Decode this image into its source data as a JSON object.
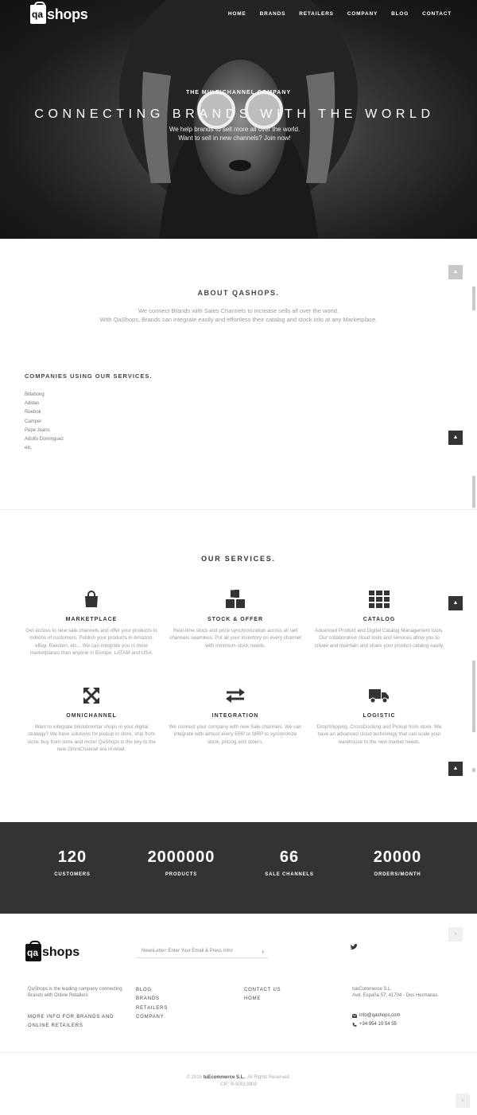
{
  "brand": {
    "logo_letters": "qa",
    "logo_word": "shops"
  },
  "nav": [
    "HOME",
    "BRANDS",
    "RETAILERS",
    "COMPANY",
    "BLOG",
    "CONTACT"
  ],
  "hero": {
    "kicker": "THE MULTICHANNEL COMPANY",
    "headline": "CONNECTING BRANDS WITH THE WORLD",
    "sub_line1": "We help brands to sell more all over the world.",
    "sub_line2": "Want to sell in new channels? Join now!"
  },
  "about": {
    "title": "ABOUT QASHOPS.",
    "line1": "We connect Brands with Sales Channels to increase sells all over the world.",
    "line2": "With QaShops, Brands can integrate easily and effortless their catalog and stock info at any Marketplace."
  },
  "companies": {
    "title": "COMPANIES USING OUR SERVICES.",
    "items": [
      "Billabong",
      "Adidas",
      "Reebok",
      "Camper",
      "Pepe Jeans",
      "Adolfo Dominguez",
      "etc."
    ]
  },
  "services": {
    "title": "OUR SERVICES.",
    "items": [
      {
        "icon": "shopping-bag-icon",
        "name": "MARKETPLACE",
        "desc": "Get access to new sale channels and offer your products to millions of customers. Publish your products in Amazon, eBay, Rakuten, etc... We can integrate you in more marketplaces than anyone in Europe, LATAM and USA."
      },
      {
        "icon": "cubes-icon",
        "name": "STOCK & OFFER",
        "desc": "Real-time stock and price synchronization across all sell channels seamless. Put all your inventory on every channel with minimum stock needs."
      },
      {
        "icon": "grid-icon",
        "name": "CATALOG",
        "desc": "Advanced Product and Digital Catalog Management tools. Our collaborative cloud tools and services allow you to create and maintain and share your product catalog easily."
      },
      {
        "icon": "expand-arrows-icon",
        "name": "OMNICHANNEL",
        "desc": "Want to integrate brick&mortar shops in your digital strategy? We have solutions for pickup in store, ship from store, buy from store and more! QaShops is the key to the new OmniChannel era in retail."
      },
      {
        "icon": "exchange-arrows-icon",
        "name": "INTEGRATION",
        "desc": "We connect your company with new Sale channels. We can integrate with almost every ERP or MRP to synchronize stock, pricing and orders."
      },
      {
        "icon": "truck-icon",
        "name": "LOGISTIC",
        "desc": "DropShipping, CrossDocking and Pickup from store. We have an advanced cloud technology that can scale your warehouse to the new market needs."
      }
    ]
  },
  "stats": [
    {
      "num": "120",
      "label": "CUSTOMERS"
    },
    {
      "num": "2000000",
      "label": "PRODUCTS"
    },
    {
      "num": "66",
      "label": "SALE CHANNELS"
    },
    {
      "num": "20000",
      "label": "ORDERS/MONTH"
    }
  ],
  "footer": {
    "newsletter_placeholder": "NewsLetter: Enter Your Email & Press Intro",
    "about_text": "QaShops is the leading company connecting Brands with Online Retailers",
    "more_info": "MORE INFO FOR BRANDS AND ONLINE RETAILERS",
    "links_col1": [
      "BLOG",
      "BRANDS",
      "RETAILERS",
      "COMPANY"
    ],
    "links_col2": [
      "CONTACT US",
      "HOME"
    ],
    "company_name": "tueCommerce S.L.",
    "address": "Avd. España 57, 41704 - Dos Hermanas",
    "email": "info@qashops.com",
    "phone": "+34 954 10 54 55",
    "copyright_pre": "© 2016",
    "copyright_company": "tuEcommerce S.L.",
    "copyright_post": ". All Rights Reserved.",
    "cif": "CIF: B-90013909"
  },
  "colors": {
    "dark": "#333333",
    "hero_bg": "#1c1c1c",
    "muted_text": "#999999"
  }
}
